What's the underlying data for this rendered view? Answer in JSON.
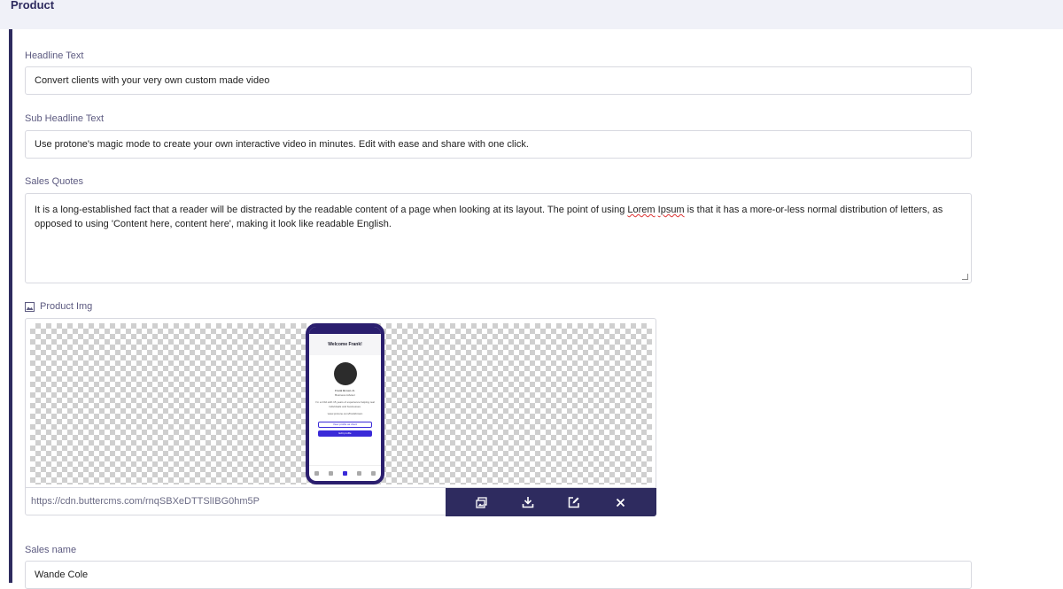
{
  "header": {
    "title": "Product"
  },
  "fields": {
    "headline": {
      "label": "Headline Text",
      "value": "Convert clients with your very own custom made video"
    },
    "subheadline": {
      "label": "Sub Headline Text",
      "value": "Use protone's magic mode to create your own interactive video in minutes. Edit with ease and share with one click."
    },
    "quotes": {
      "label": "Sales Quotes",
      "text_before": "It is a long-established fact that a reader will be distracted by the readable content of a page when looking at its layout. The point of using ",
      "misspelled_1": "Lorem",
      "space": " ",
      "misspelled_2": "Ipsum",
      "text_after": " is that it has a more-or-less normal distribution of letters, as opposed to using 'Content here, content here', making it look like readable English."
    },
    "product_img": {
      "label": "Product Img",
      "url": "https://cdn.buttercms.com/rnqSBXeDTTSlIBG0hm5P",
      "phone": {
        "welcome": "Welcome Frank!",
        "name": "Frank Brown Jr.",
        "role": "Business Advisor",
        "bio": "I'm a CFA with 15 years of experience helping real individuals and businesses.",
        "website": "www.protone.com/frankbrown",
        "btn_view": "View profile as client",
        "btn_edit": "Edit profile"
      },
      "icons": [
        "image-gallery-icon",
        "download-icon",
        "edit-icon",
        "close-icon"
      ]
    },
    "sales_name": {
      "label": "Sales name",
      "value": "Wande Cole"
    }
  },
  "colors": {
    "accent": "#2e2b5f",
    "phone_frame": "#2a1e6e",
    "button": "#3a2ad8"
  }
}
